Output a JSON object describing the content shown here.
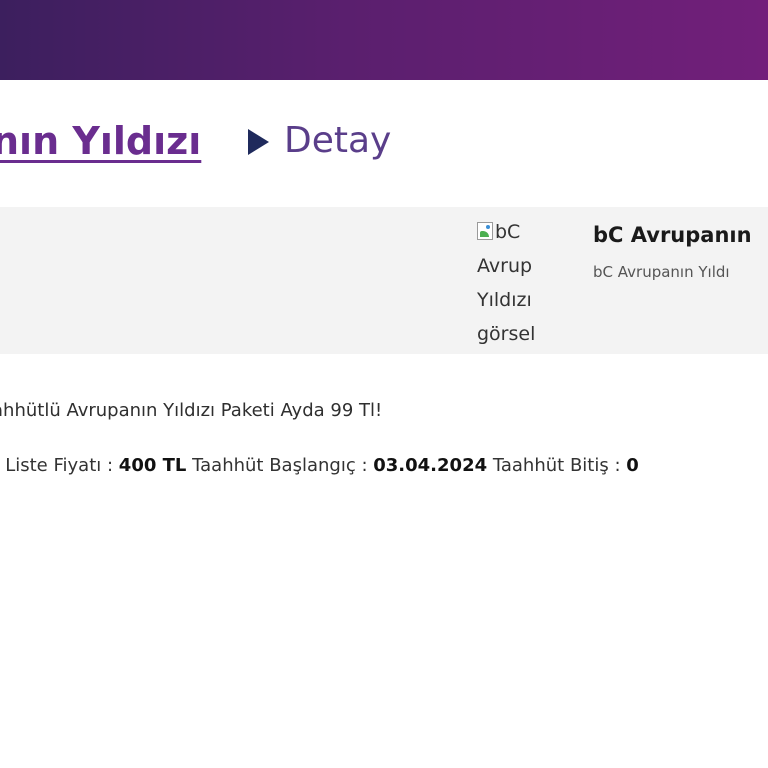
{
  "breadcrumb": {
    "parent_label": "nın Yıldızı",
    "current_label": "Detay"
  },
  "card": {
    "image_alt": "bC Avrup Yıldızı görsel",
    "alt_lines": [
      "bC",
      "Avrup",
      "Yıldızı",
      "görsel"
    ],
    "title": "bC Avrupanın",
    "subtitle": "bC Avrupanın Yıldı"
  },
  "details": {
    "description": "ahhütlü Avrupanın Yıldızı Paketi Ayda 99 Tl!",
    "price_prefix_value": "L",
    "list_price_label": "Liste Fiyatı :",
    "list_price_value": "400 TL",
    "commit_start_label": "Taahhüt Başlangıç :",
    "commit_start_value": "03.04.2024",
    "commit_end_label": "Taahhüt Bitiş :",
    "commit_end_value": "0"
  },
  "colors": {
    "header_gradient_start": "#3c1f5e",
    "header_gradient_end": "#721f7a",
    "breadcrumb_link": "#6a2d8f",
    "breadcrumb_arrow": "#1f2a5c",
    "card_background": "#f3f3f3"
  }
}
